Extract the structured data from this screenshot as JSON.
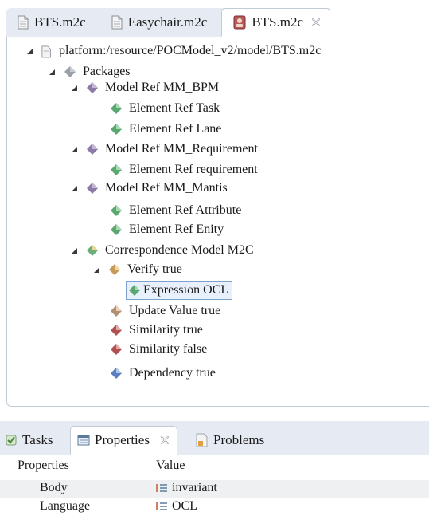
{
  "editor_tabs": [
    {
      "label": "BTS.m2c",
      "icon": "document-icon",
      "active": false
    },
    {
      "label": "Easychair.m2c",
      "icon": "document-icon",
      "active": false
    },
    {
      "label": "BTS.m2c",
      "icon": "model-editor-icon",
      "active": true
    }
  ],
  "tree": {
    "root": "platform:/resource/POCModel_v2/model/BTS.m2c",
    "packages": "Packages",
    "nodes": {
      "mm_bpm": "Model Ref MM_BPM",
      "task": "Element Ref Task",
      "lane": "Element Ref Lane",
      "mm_req": "Model Ref MM_Requirement",
      "requirement": "Element Ref requirement",
      "mm_mantis": "Model Ref MM_Mantis",
      "attribute": "Element Ref Attribute",
      "enity": "Element Ref Enity",
      "corr": "Correspondence Model M2C",
      "verify": "Verify true",
      "expression": "Expression OCL",
      "update": "Update Value true",
      "sim_true": "Similarity true",
      "sim_false": "Similarity false",
      "dependency": "Dependency true"
    }
  },
  "bottom_tabs": {
    "tasks": "Tasks",
    "properties": "Properties",
    "problems": "Problems"
  },
  "properties": {
    "col_property": "Properties",
    "col_value": "Value",
    "rows": [
      {
        "name": "Body",
        "value": "invariant"
      },
      {
        "name": "Language",
        "value": "OCL"
      }
    ]
  },
  "colors": {
    "tab_strip": "#e6ebf3",
    "border": "#c2cad6",
    "selection": "#e8f1fb",
    "icon_gray": "#9aa0a8",
    "icon_green": "#5aa870",
    "icon_purple": "#8c7aa8",
    "icon_red": "#b05050",
    "icon_blue": "#5a7fc0"
  }
}
